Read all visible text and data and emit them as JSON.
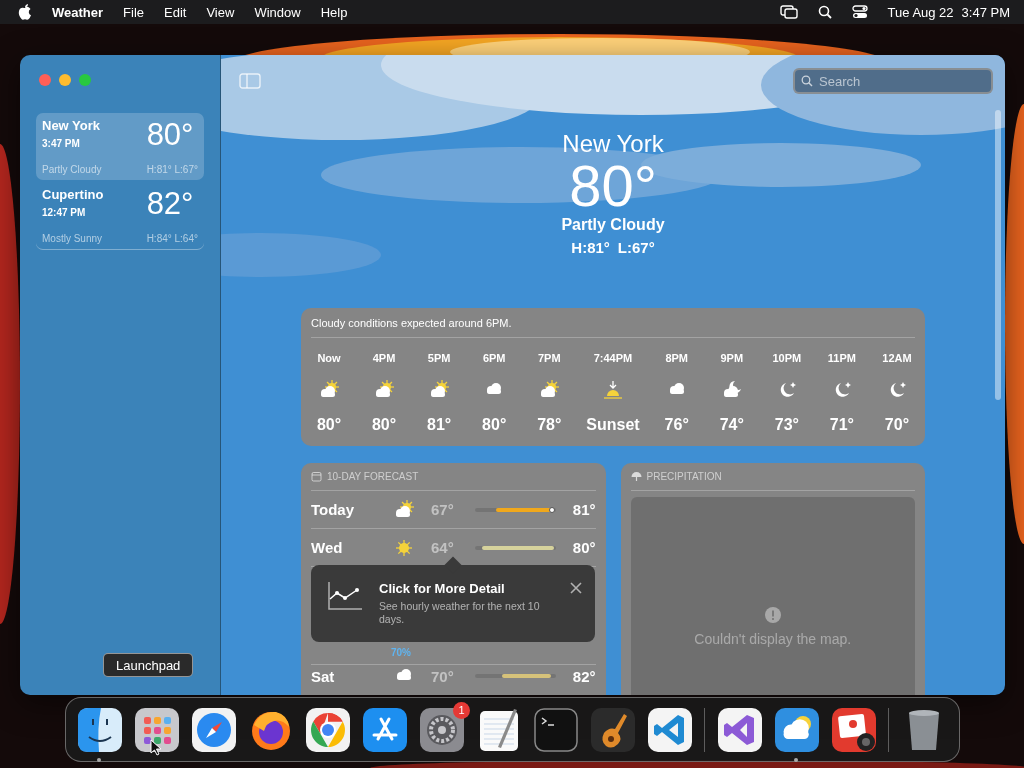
{
  "menu_bar": {
    "app_name": "Weather",
    "menus": [
      "File",
      "Edit",
      "View",
      "Window",
      "Help"
    ],
    "date": "Tue Aug 22",
    "time": "3:47 PM"
  },
  "sidebar": {
    "locations": [
      {
        "name": "New York",
        "time": "3:47 PM",
        "temperature": "80°",
        "condition": "Partly Cloudy",
        "high_low": "H:81° L:67°",
        "selected": true
      },
      {
        "name": "Cupertino",
        "time": "12:47 PM",
        "temperature": "82°",
        "condition": "Mostly Sunny",
        "high_low": "H:84° L:64°",
        "selected": false
      }
    ]
  },
  "search": {
    "placeholder": "Search"
  },
  "current": {
    "city": "New York",
    "temperature": "80°",
    "condition": "Partly Cloudy",
    "high": "H:81°",
    "low": "L:67°"
  },
  "hourly": {
    "summary": "Cloudy conditions expected around 6PM.",
    "hours": [
      {
        "time": "Now",
        "kind": "partly-cloudy",
        "temperature": "80°"
      },
      {
        "time": "4PM",
        "kind": "partly-cloudy",
        "temperature": "80°"
      },
      {
        "time": "5PM",
        "kind": "partly-cloudy",
        "temperature": "81°"
      },
      {
        "time": "6PM",
        "kind": "cloud",
        "temperature": "80°"
      },
      {
        "time": "7PM",
        "kind": "partly-cloudy",
        "temperature": "78°"
      },
      {
        "time": "7:44PM",
        "kind": "sunset",
        "temperature": "Sunset"
      },
      {
        "time": "8PM",
        "kind": "cloud",
        "temperature": "76°"
      },
      {
        "time": "9PM",
        "kind": "cloud-moon",
        "temperature": "74°"
      },
      {
        "time": "10PM",
        "kind": "moon",
        "temperature": "73°"
      },
      {
        "time": "11PM",
        "kind": "moon",
        "temperature": "71°"
      },
      {
        "time": "12AM",
        "kind": "moon",
        "temperature": "70°"
      }
    ]
  },
  "forecast": {
    "title": "10-DAY FORECAST",
    "days": [
      {
        "kind": "day",
        "day": "Today",
        "icon": {
          "kind": "partly-cloudy"
        },
        "low": "67°",
        "high": "81°",
        "level": 0.7,
        "color": "#f0a81c",
        "now": true
      },
      {
        "kind": "day",
        "day": "Wed",
        "icon": {
          "kind": "sun"
        },
        "low": "64°",
        "high": "80°",
        "level": 0.9,
        "color": "#d6d29c",
        "now": false
      },
      {
        "kind": "covered",
        "precipitation": "70%"
      },
      {
        "kind": "day",
        "day": "Sat",
        "icon": {
          "kind": "cloud"
        },
        "low": "70°",
        "high": "82°",
        "level": 0.6,
        "color": "#d6c27a",
        "now": false
      }
    ]
  },
  "tooltip": {
    "title": "Click for More Detail",
    "text": "See hourly weather for the next 10 days."
  },
  "precipitation": {
    "title": "PRECIPITATION",
    "message": "Couldn't display the map."
  },
  "dock": {
    "tooltip": "Launchpad",
    "apps": [
      {
        "kind": "finder",
        "running": true
      },
      {
        "kind": "launchpad",
        "running": false
      },
      {
        "kind": "safari",
        "running": false
      },
      {
        "kind": "firefox",
        "running": false
      },
      {
        "kind": "chrome",
        "running": false
      },
      {
        "kind": "appstore",
        "running": false
      },
      {
        "kind": "settings",
        "running": false,
        "badge": "1"
      },
      {
        "kind": "textedit",
        "running": false
      },
      {
        "kind": "terminal",
        "running": false
      },
      {
        "kind": "garageband",
        "running": false
      },
      {
        "kind": "vscode",
        "running": false
      },
      {
        "kind": "separator"
      },
      {
        "kind": "visualstudio",
        "running": false
      },
      {
        "kind": "weather",
        "running": true
      },
      {
        "kind": "photobooth",
        "running": false
      },
      {
        "kind": "separator"
      },
      {
        "kind": "trash",
        "running": false
      }
    ]
  }
}
